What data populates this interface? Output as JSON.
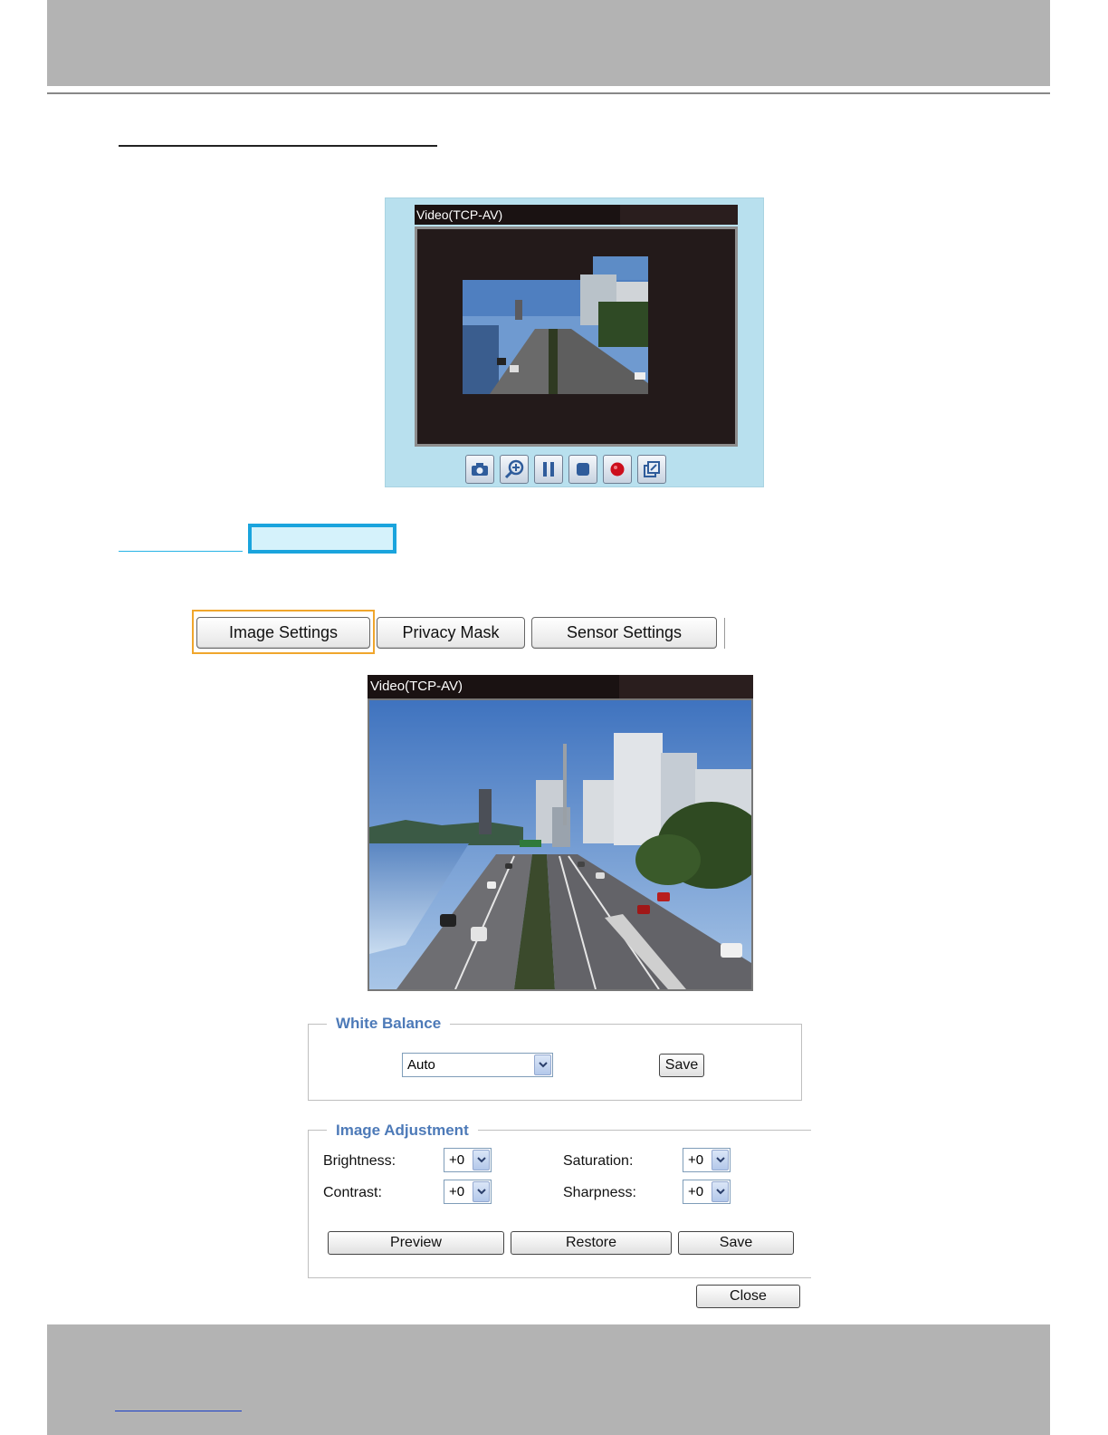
{
  "mini_viewer": {
    "title": "Video(TCP-AV)",
    "controls": [
      {
        "icon": "camera-icon"
      },
      {
        "icon": "zoom-in-icon"
      },
      {
        "icon": "pause-icon"
      },
      {
        "icon": "stop-icon"
      },
      {
        "icon": "record-icon"
      },
      {
        "icon": "fullscreen-icon"
      }
    ]
  },
  "tabs": {
    "image_settings": "Image Settings",
    "privacy_mask": "Privacy Mask",
    "sensor_settings": "Sensor Settings"
  },
  "main_viewer": {
    "title": "Video(TCP-AV)"
  },
  "white_balance": {
    "legend": "White Balance",
    "value": "Auto",
    "save_label": "Save"
  },
  "image_adjustment": {
    "legend": "Image Adjustment",
    "brightness_label": "Brightness:",
    "brightness_value": "+0",
    "saturation_label": "Saturation:",
    "saturation_value": "+0",
    "contrast_label": "Contrast:",
    "contrast_value": "+0",
    "sharpness_label": "Sharpness:",
    "sharpness_value": "+0",
    "preview_label": "Preview",
    "restore_label": "Restore",
    "save_label": "Save"
  },
  "close_label": "Close",
  "colors": {
    "accent_highlight": "#f0a62c",
    "link_highlight": "#1aa4dd",
    "legend_blue": "#4d7ab8"
  }
}
